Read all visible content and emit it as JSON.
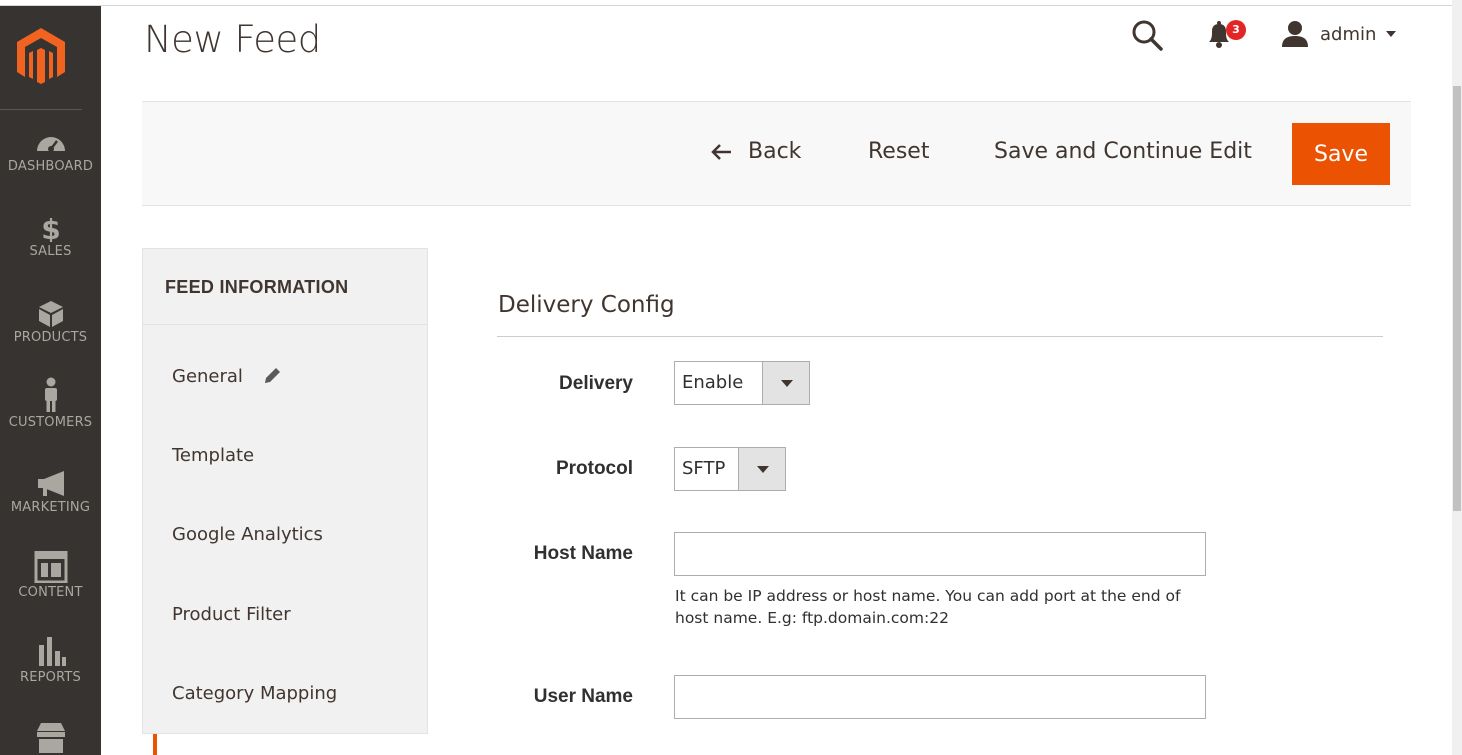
{
  "header": {
    "title": "New Feed",
    "notifications_count": "3",
    "user_name": "admin"
  },
  "sidebar": {
    "items": [
      {
        "label": "DASHBOARD",
        "icon": "dashboard-icon"
      },
      {
        "label": "SALES",
        "icon": "dollar-icon"
      },
      {
        "label": "PRODUCTS",
        "icon": "cube-icon"
      },
      {
        "label": "CUSTOMERS",
        "icon": "person-icon"
      },
      {
        "label": "MARKETING",
        "icon": "megaphone-icon"
      },
      {
        "label": "CONTENT",
        "icon": "layout-icon"
      },
      {
        "label": "REPORTS",
        "icon": "bar-chart-icon"
      },
      {
        "label": "",
        "icon": "store-icon"
      }
    ]
  },
  "actions": {
    "back": "Back",
    "reset": "Reset",
    "save_continue": "Save and Continue Edit",
    "save": "Save"
  },
  "tabs": {
    "heading": "FEED INFORMATION",
    "items": [
      "General",
      "Template",
      "Google Analytics",
      "Product Filter",
      "Category Mapping"
    ]
  },
  "form": {
    "section_title": "Delivery Config",
    "delivery": {
      "label": "Delivery",
      "value": "Enable"
    },
    "protocol": {
      "label": "Protocol",
      "value": "SFTP"
    },
    "host_name": {
      "label": "Host Name",
      "value": "",
      "note": "It can be IP address or host name. You can add port at the end of host name. E.g: ftp.domain.com:22"
    },
    "user_name": {
      "label": "User Name",
      "value": ""
    }
  },
  "colors": {
    "accent": "#eb5202",
    "sidebar_bg": "#373330",
    "badge": "#e22626"
  }
}
